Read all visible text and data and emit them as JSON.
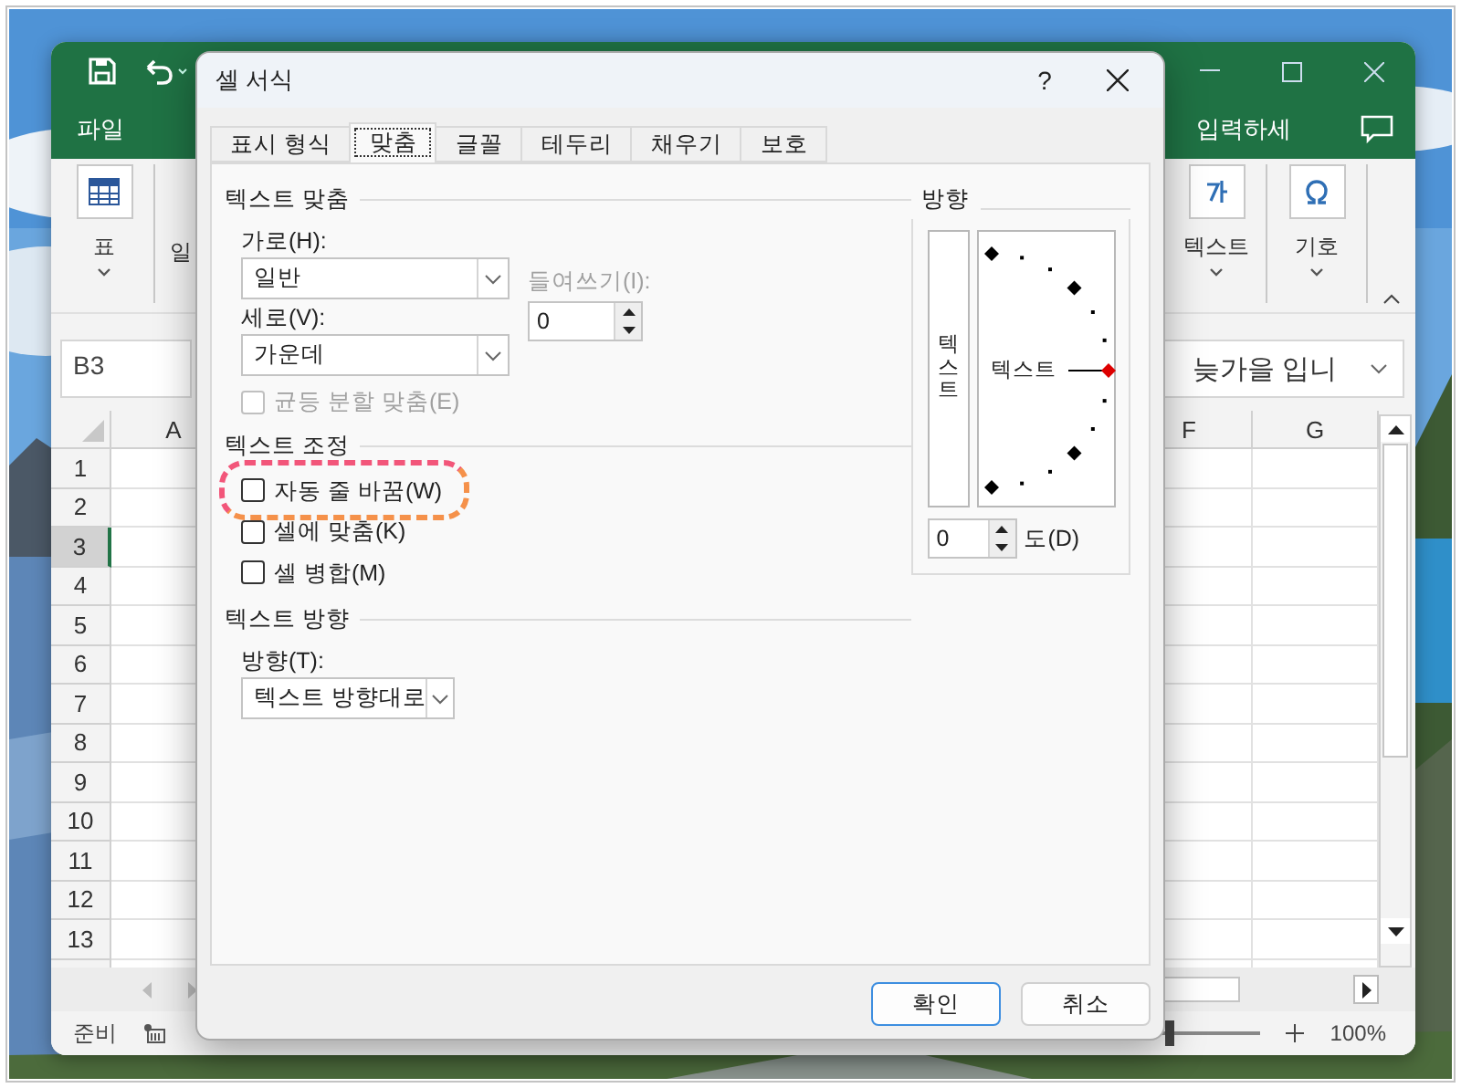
{
  "excel": {
    "menu_tabs": [
      {
        "label": "파일"
      }
    ],
    "search_hint": "입력하세",
    "ribbon_left": [
      {
        "kind": "table",
        "label": "표"
      }
    ],
    "ribbon_cut_label": "일",
    "ribbon_right": [
      {
        "kind": "text",
        "label": "텍스트"
      },
      {
        "kind": "symbol",
        "label": "기호"
      }
    ],
    "name_box": "B3",
    "formula": "늦가을 입니",
    "columns": [
      {
        "label": "A"
      },
      {
        "label": "F"
      },
      {
        "label": "G"
      }
    ],
    "rows": [
      {
        "label": "1",
        "selected": false
      },
      {
        "label": "2",
        "selected": false
      },
      {
        "label": "3",
        "selected": true
      },
      {
        "label": "4",
        "selected": false
      },
      {
        "label": "5",
        "selected": false
      },
      {
        "label": "6",
        "selected": false
      },
      {
        "label": "7",
        "selected": false
      },
      {
        "label": "8",
        "selected": false
      },
      {
        "label": "9",
        "selected": false
      },
      {
        "label": "10",
        "selected": false
      },
      {
        "label": "11",
        "selected": false
      },
      {
        "label": "12",
        "selected": false
      },
      {
        "label": "13",
        "selected": false
      }
    ],
    "status": "준비",
    "zoom_slider": {
      "level": 0.5
    },
    "zoom": "100%"
  },
  "dialog": {
    "title": "셀 서식",
    "help": "?",
    "tabs": [
      {
        "label": "표시 형식",
        "selected": false
      },
      {
        "label": "맞춤",
        "selected": true
      },
      {
        "label": "글꼴",
        "selected": false
      },
      {
        "label": "테두리",
        "selected": false
      },
      {
        "label": "채우기",
        "selected": false
      },
      {
        "label": "보호",
        "selected": false
      }
    ],
    "alignment": {
      "title": "텍스트 맞춤",
      "horizontal": {
        "label": "가로(H):",
        "value": "일반"
      },
      "indent": {
        "label": "들여쓰기(I):",
        "value": "0",
        "disabled": true
      },
      "vertical": {
        "label": "세로(V):",
        "value": "가운데"
      },
      "distributed": {
        "label": "균등 분할 맞춤(E)",
        "checked": false,
        "disabled": true
      }
    },
    "text_control": {
      "title": "텍스트 조정",
      "options": [
        {
          "label": "자동 줄 바꿈(W)",
          "checked": false,
          "highlighted": true
        },
        {
          "label": "셀에 맞춤(K)",
          "checked": false,
          "highlighted": false
        },
        {
          "label": "셀 병합(M)",
          "checked": false,
          "highlighted": false
        }
      ]
    },
    "direction": {
      "title": "텍스트 방향",
      "label": "방향(T):",
      "value": "텍스트 방향대로"
    },
    "orientation": {
      "title": "방향",
      "vertical_text": "텍스트",
      "dial_text": "텍스트",
      "degrees": "0",
      "unit": "도(D)"
    },
    "buttons": [
      {
        "label": "확인",
        "default": true
      },
      {
        "label": "취소",
        "default": false
      }
    ]
  }
}
